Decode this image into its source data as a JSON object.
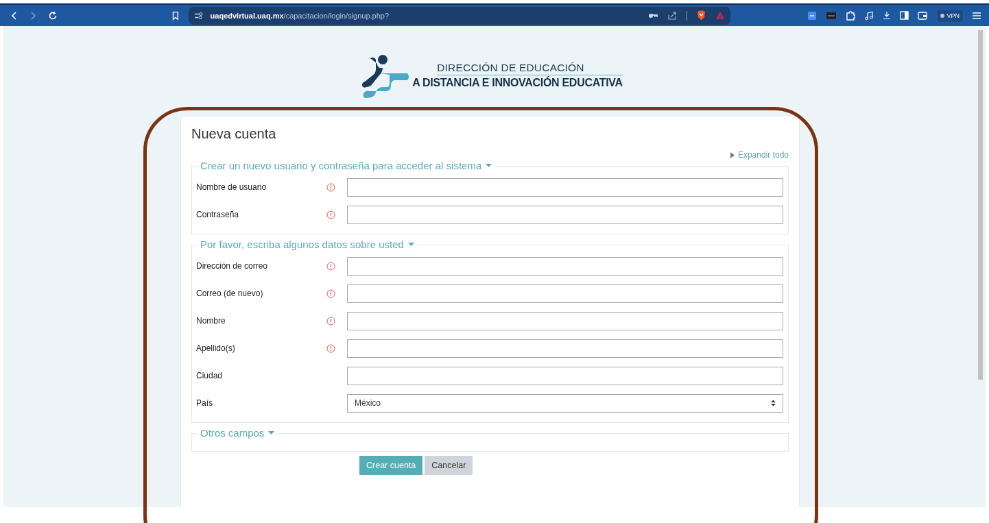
{
  "browser": {
    "url_host": "uaqedvirtual.uaq.mx",
    "url_path": "/capacitacion/login/signup.php?",
    "vpn_label": "VPN"
  },
  "logo": {
    "line_1": "DIRECCIÓN DE EDUCACIÓN",
    "line_2": "A DISTANCIA E INNOVACIÓN EDUCATIVA"
  },
  "form": {
    "title": "Nueva cuenta",
    "expand_all": "Expandir todo",
    "sections": [
      {
        "legend": "Crear un nuevo usuario y contraseña para acceder al sistema",
        "expanded": true,
        "fields": [
          {
            "label": "Nombre de usuario",
            "required": true,
            "kind": "text"
          },
          {
            "label": "Contraseña",
            "required": true,
            "kind": "text"
          }
        ]
      },
      {
        "legend": "Por favor, escriba algunos datos sobre usted",
        "expanded": true,
        "fields": [
          {
            "label": "Dirección de correo",
            "required": true,
            "kind": "text"
          },
          {
            "label": "Correo (de nuevo)",
            "required": true,
            "kind": "text"
          },
          {
            "label": "Nombre",
            "required": true,
            "kind": "text"
          },
          {
            "label": "Apellido(s)",
            "required": true,
            "kind": "text"
          },
          {
            "label": "Ciudad",
            "required": false,
            "kind": "text"
          },
          {
            "label": "País",
            "required": false,
            "kind": "select",
            "value": "México"
          }
        ]
      },
      {
        "legend": "Otros campos",
        "expanded": true
      }
    ],
    "buttons": [
      {
        "label": "Crear cuenta",
        "kind": "primary"
      },
      {
        "label": "Cancelar",
        "kind": "secondary"
      }
    ]
  }
}
